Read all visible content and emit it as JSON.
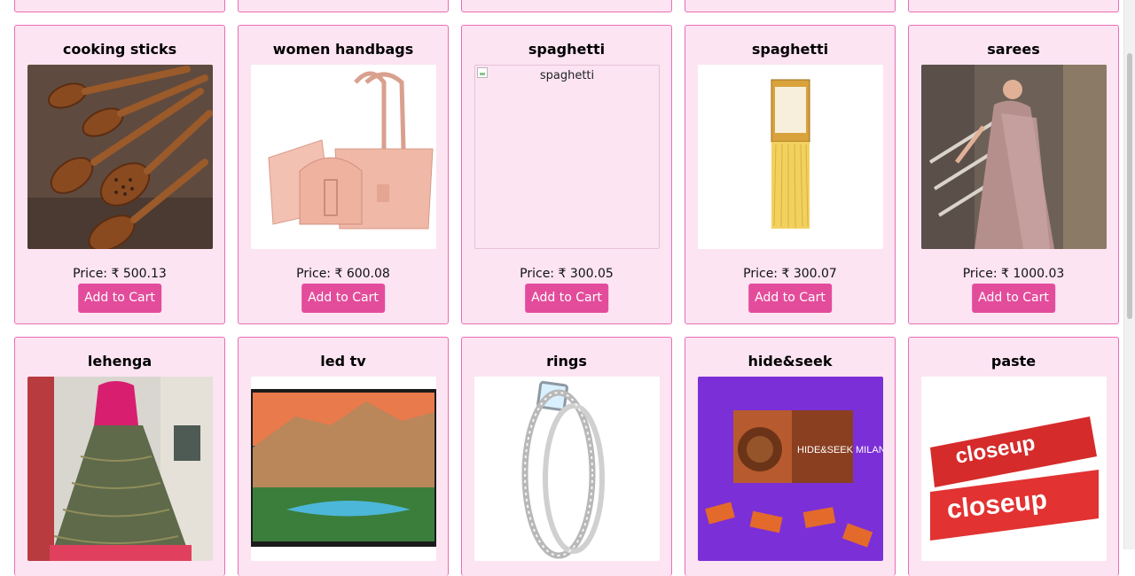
{
  "products_row2": [
    {
      "name": "cooking sticks",
      "price": "Price: ₹ 500.13",
      "cart": "Add to Cart"
    },
    {
      "name": "women handbags",
      "price": "Price: ₹ 600.08",
      "cart": "Add to Cart"
    },
    {
      "name": "spaghetti",
      "alt": "spaghetti",
      "price": "Price: ₹ 300.05",
      "cart": "Add to Cart"
    },
    {
      "name": "spaghetti",
      "price": "Price: ₹ 300.07",
      "cart": "Add to Cart"
    },
    {
      "name": "sarees",
      "price": "Price: ₹ 1000.03",
      "cart": "Add to Cart"
    }
  ],
  "products_row3": [
    {
      "name": "lehenga"
    },
    {
      "name": "led tv"
    },
    {
      "name": "rings"
    },
    {
      "name": "hide&seek",
      "image_text": "HIDE&SEEK MILANO"
    },
    {
      "name": "paste",
      "image_text": "closeup"
    }
  ],
  "colors": {
    "card_bg": "#fce4f2",
    "card_border": "#e86fb4",
    "button": "#e34c9b"
  }
}
